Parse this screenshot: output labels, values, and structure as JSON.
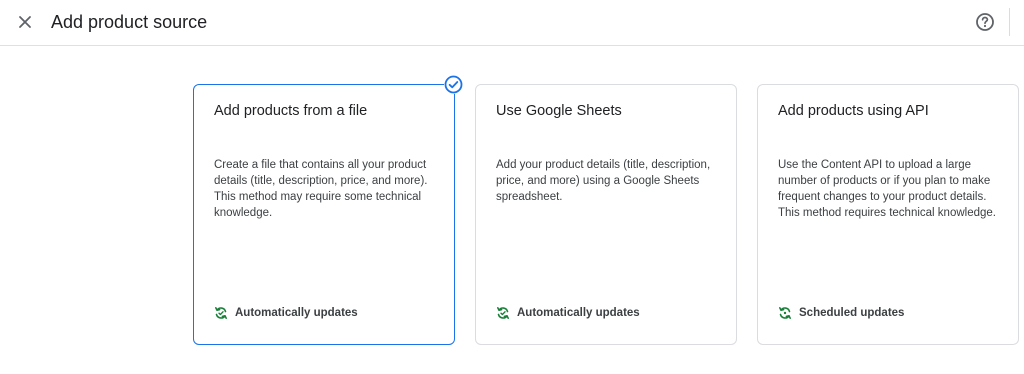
{
  "header": {
    "title": "Add product source",
    "close_icon": "close-icon",
    "help_icon": "help-icon"
  },
  "cards": [
    {
      "title": "Add products from a file",
      "description": "Create a file that contains all your product details (title, description, price, and more). This method may require some technical knowledge.",
      "footer": "Automatically updates",
      "footer_icon": "sync-icon",
      "selected": true
    },
    {
      "title": "Use Google Sheets",
      "description": "Add your product details (title, description, price, and more) using a Google Sheets spreadsheet.",
      "footer": "Automatically updates",
      "footer_icon": "sync-icon",
      "selected": false
    },
    {
      "title": "Add products using API",
      "description": "Use the Content API to upload a large number of products or if you plan to make frequent changes to your product details. This method requires technical knowledge.",
      "footer": "Scheduled updates",
      "footer_icon": "sync-icon",
      "selected": false
    }
  ],
  "colors": {
    "accent": "#1a73e8",
    "sync_icon": "#188038",
    "border": "#dadce0"
  }
}
